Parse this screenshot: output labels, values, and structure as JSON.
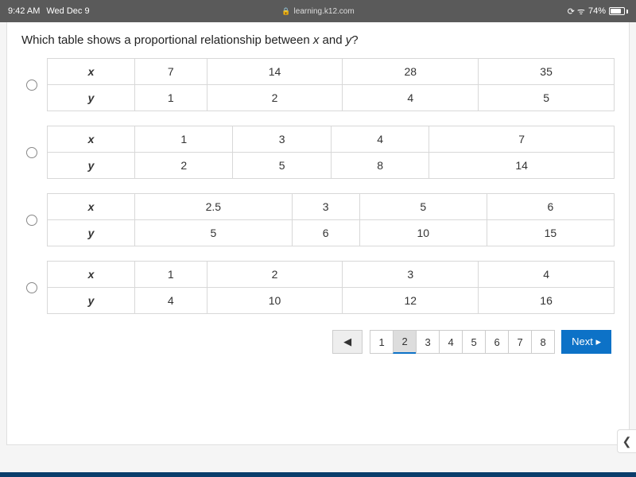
{
  "status": {
    "time": "9:42 AM",
    "date": "Wed Dec 9",
    "url": "learning.k12.com",
    "battery": "74%"
  },
  "question": {
    "prefix": "Which table shows a proportional relationship between ",
    "var1": "x",
    "mid": " and ",
    "var2": "y",
    "suffix": "?"
  },
  "row_headers": {
    "x": "x",
    "y": "y"
  },
  "tables": [
    {
      "x": [
        "7",
        "14",
        "28",
        "35"
      ],
      "y": [
        "1",
        "2",
        "4",
        "5"
      ]
    },
    {
      "x": [
        "1",
        "3",
        "4",
        "7"
      ],
      "y": [
        "2",
        "5",
        "8",
        "14"
      ]
    },
    {
      "x": [
        "2.5",
        "3",
        "5",
        "6"
      ],
      "y": [
        "5",
        "6",
        "10",
        "15"
      ]
    },
    {
      "x": [
        "1",
        "2",
        "3",
        "4"
      ],
      "y": [
        "4",
        "10",
        "12",
        "16"
      ]
    }
  ],
  "pagination": {
    "prev": "◀",
    "pages": [
      "1",
      "2",
      "3",
      "4",
      "5",
      "6",
      "7",
      "8"
    ],
    "active_index": 1,
    "next": "Next ▸"
  },
  "side_tab": "❮"
}
